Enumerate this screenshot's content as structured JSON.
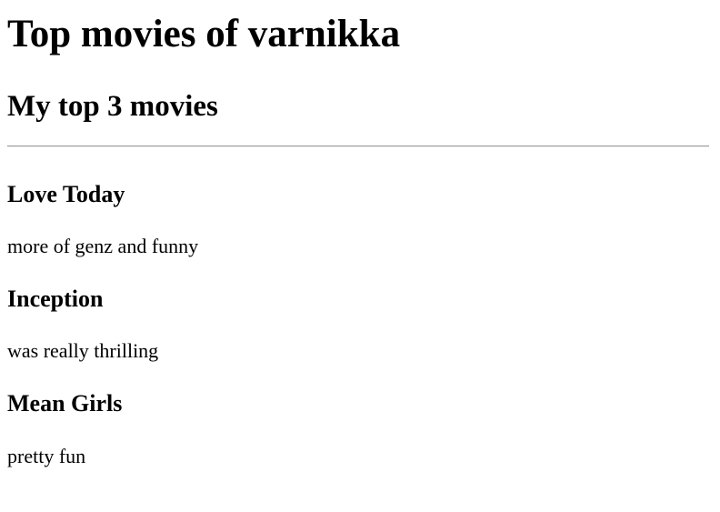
{
  "page": {
    "title": "Top movies of varnikka",
    "subtitle": "My top 3 movies"
  },
  "movies": [
    {
      "title": "Love Today",
      "description": "more of genz and funny"
    },
    {
      "title": "Inception",
      "description": "was really thrilling"
    },
    {
      "title": "Mean Girls",
      "description": "pretty fun"
    }
  ]
}
